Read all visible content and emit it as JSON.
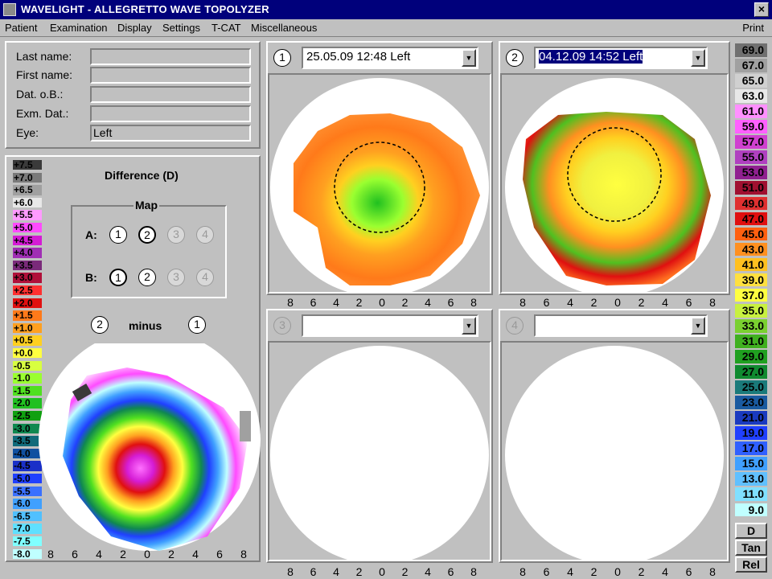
{
  "window": {
    "title": "WAVELIGHT  -  ALLEGRETTO WAVE TOPOLYZER",
    "close_glyph": "×"
  },
  "menu": {
    "items": [
      "Patient",
      "Examination",
      "Display",
      "Settings",
      "T-CAT",
      "Miscellaneous"
    ],
    "print": "Print"
  },
  "patient": {
    "last_name_label": "Last name:",
    "last_name_value": "",
    "first_name_label": "First name:",
    "first_name_value": "",
    "dob_label": "Dat. o.B.:",
    "dob_value": "",
    "exam_label": "Exm. Dat.:",
    "exam_value": "",
    "eye_label": "Eye:",
    "eye_value": "Left"
  },
  "difference": {
    "title": "Difference (D)",
    "map_label": "Map",
    "row_a_label": "A:",
    "row_b_label": "B:",
    "buttons": [
      "1",
      "2",
      "3",
      "4"
    ],
    "minus_label": "minus",
    "minuend": "2",
    "subtrahend": "1",
    "scale": [
      "+7.5",
      "+7.0",
      "+6.5",
      "+6.0",
      "+5.5",
      "+5.0",
      "+4.5",
      "+4.0",
      "+3.5",
      "+3.0",
      "+2.5",
      "+2.0",
      "+1.5",
      "+1.0",
      "+0.5",
      "+0.0",
      "-0.5",
      "-1.0",
      "-1.5",
      "-2.0",
      "-2.5",
      "-3.0",
      "-3.5",
      "-4.0",
      "-4.5",
      "-5.0",
      "-5.5",
      "-6.0",
      "-6.5",
      "-7.0",
      "-7.5",
      "-8.0"
    ],
    "scale_colors": [
      "#3a3a3a",
      "#7a7a7a",
      "#a0a0a0",
      "#e8e8e8",
      "#ff9bff",
      "#ff4bff",
      "#d51cd5",
      "#a02eb4",
      "#7a2a7a",
      "#b0103a",
      "#ff3030",
      "#e01010",
      "#ff7a1a",
      "#ffa020",
      "#ffd020",
      "#ffff40",
      "#d8ff40",
      "#9aff30",
      "#50e020",
      "#20c020",
      "#10a010",
      "#108850",
      "#106a7a",
      "#1050a0",
      "#1a30c8",
      "#2040ff",
      "#3a70ff",
      "#40a0ff",
      "#50c0ff",
      "#60e0ff",
      "#80ffff",
      "#c0ffff"
    ]
  },
  "maps": [
    {
      "number": "1",
      "exam": "25.05.09  12:48 Left",
      "selected": false,
      "active": true
    },
    {
      "number": "2",
      "exam": "04.12.09  14:52 Left",
      "selected": true,
      "active": true
    },
    {
      "number": "3",
      "exam": "",
      "selected": false,
      "active": false
    },
    {
      "number": "4",
      "exam": "",
      "selected": false,
      "active": false
    }
  ],
  "axis_labels": [
    "8",
    "6",
    "4",
    "2",
    "0",
    "2",
    "4",
    "6",
    "8"
  ],
  "scale": {
    "values": [
      "69.0",
      "67.0",
      "65.0",
      "63.0",
      "61.0",
      "59.0",
      "57.0",
      "55.0",
      "53.0",
      "51.0",
      "49.0",
      "47.0",
      "45.0",
      "43.0",
      "41.0",
      "39.0",
      "37.0",
      "35.0",
      "33.0",
      "31.0",
      "29.0",
      "27.0",
      "25.0",
      "23.0",
      "21.0",
      "19.0",
      "17.0",
      "15.0",
      "13.0",
      "11.0",
      "9.0"
    ],
    "colors": [
      "#707070",
      "#a0a0a0",
      "#d0d0d0",
      "#e8e8e8",
      "#ff90ff",
      "#ff60ff",
      "#d040d0",
      "#b040c0",
      "#902090",
      "#a01030",
      "#e03030",
      "#e01010",
      "#ff6010",
      "#ff9020",
      "#ffc020",
      "#ffe040",
      "#ffff40",
      "#c8f040",
      "#7ad030",
      "#40b020",
      "#20a020",
      "#108a30",
      "#1a7a7a",
      "#1a5aa0",
      "#1a3ac0",
      "#2040ff",
      "#3060ff",
      "#40a0ff",
      "#60c0ff",
      "#80e0ff",
      "#c0ffff"
    ],
    "buttons": [
      "D",
      "Tan",
      "Rel"
    ]
  }
}
